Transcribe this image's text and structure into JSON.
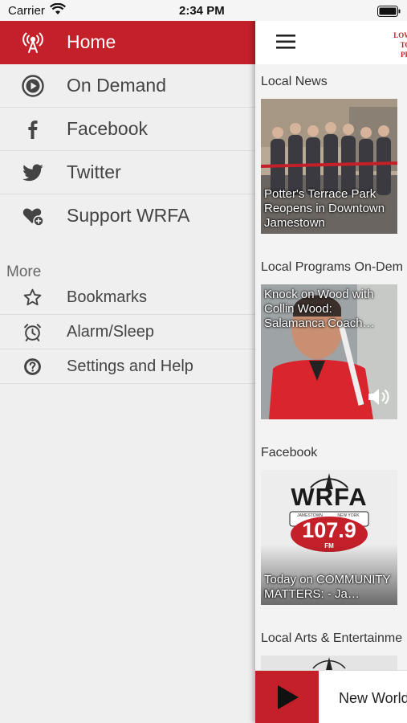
{
  "status_bar": {
    "carrier": "Carrier",
    "time": "2:34 PM"
  },
  "drawer": {
    "nav_items": [
      {
        "label": "Home",
        "icon": "radio-tower-icon",
        "active": true
      },
      {
        "label": "On Demand",
        "icon": "play-circle-icon",
        "active": false
      },
      {
        "label": "Facebook",
        "icon": "facebook-icon",
        "active": false
      },
      {
        "label": "Twitter",
        "icon": "twitter-icon",
        "active": false
      },
      {
        "label": "Support WRFA",
        "icon": "heart-plus-icon",
        "active": false
      }
    ],
    "more_title": "More",
    "more_items": [
      {
        "label": "Bookmarks",
        "icon": "star-icon"
      },
      {
        "label": "Alarm/Sleep",
        "icon": "alarm-clock-icon"
      },
      {
        "label": "Settings and Help",
        "icon": "help-gear-icon"
      }
    ]
  },
  "main": {
    "logo_lines": [
      "LOW P",
      "TO",
      "PR"
    ],
    "sections": [
      {
        "title": "Local News",
        "tile_caption": "Potter's Terrace Park Reopens in Downtown Jamestown"
      },
      {
        "title": "Local Programs On-Dem",
        "tile_caption": "Knock on Wood with Collin Wood: Salamanca Coach…"
      },
      {
        "title": "Facebook",
        "tile_caption": "Today on COMMUNITY MATTERS:  - Ja…"
      },
      {
        "title": "Local Arts & Entertainme"
      }
    ],
    "facebook_logo": {
      "name": "WRFA",
      "frequency": "107.9",
      "band": "FM",
      "location_left": "JAMESTOWN",
      "location_right": "NEW YORK"
    }
  },
  "player": {
    "now_playing": "New World"
  },
  "colors": {
    "accent": "#c4202a",
    "drawer_bg": "#efefef"
  }
}
